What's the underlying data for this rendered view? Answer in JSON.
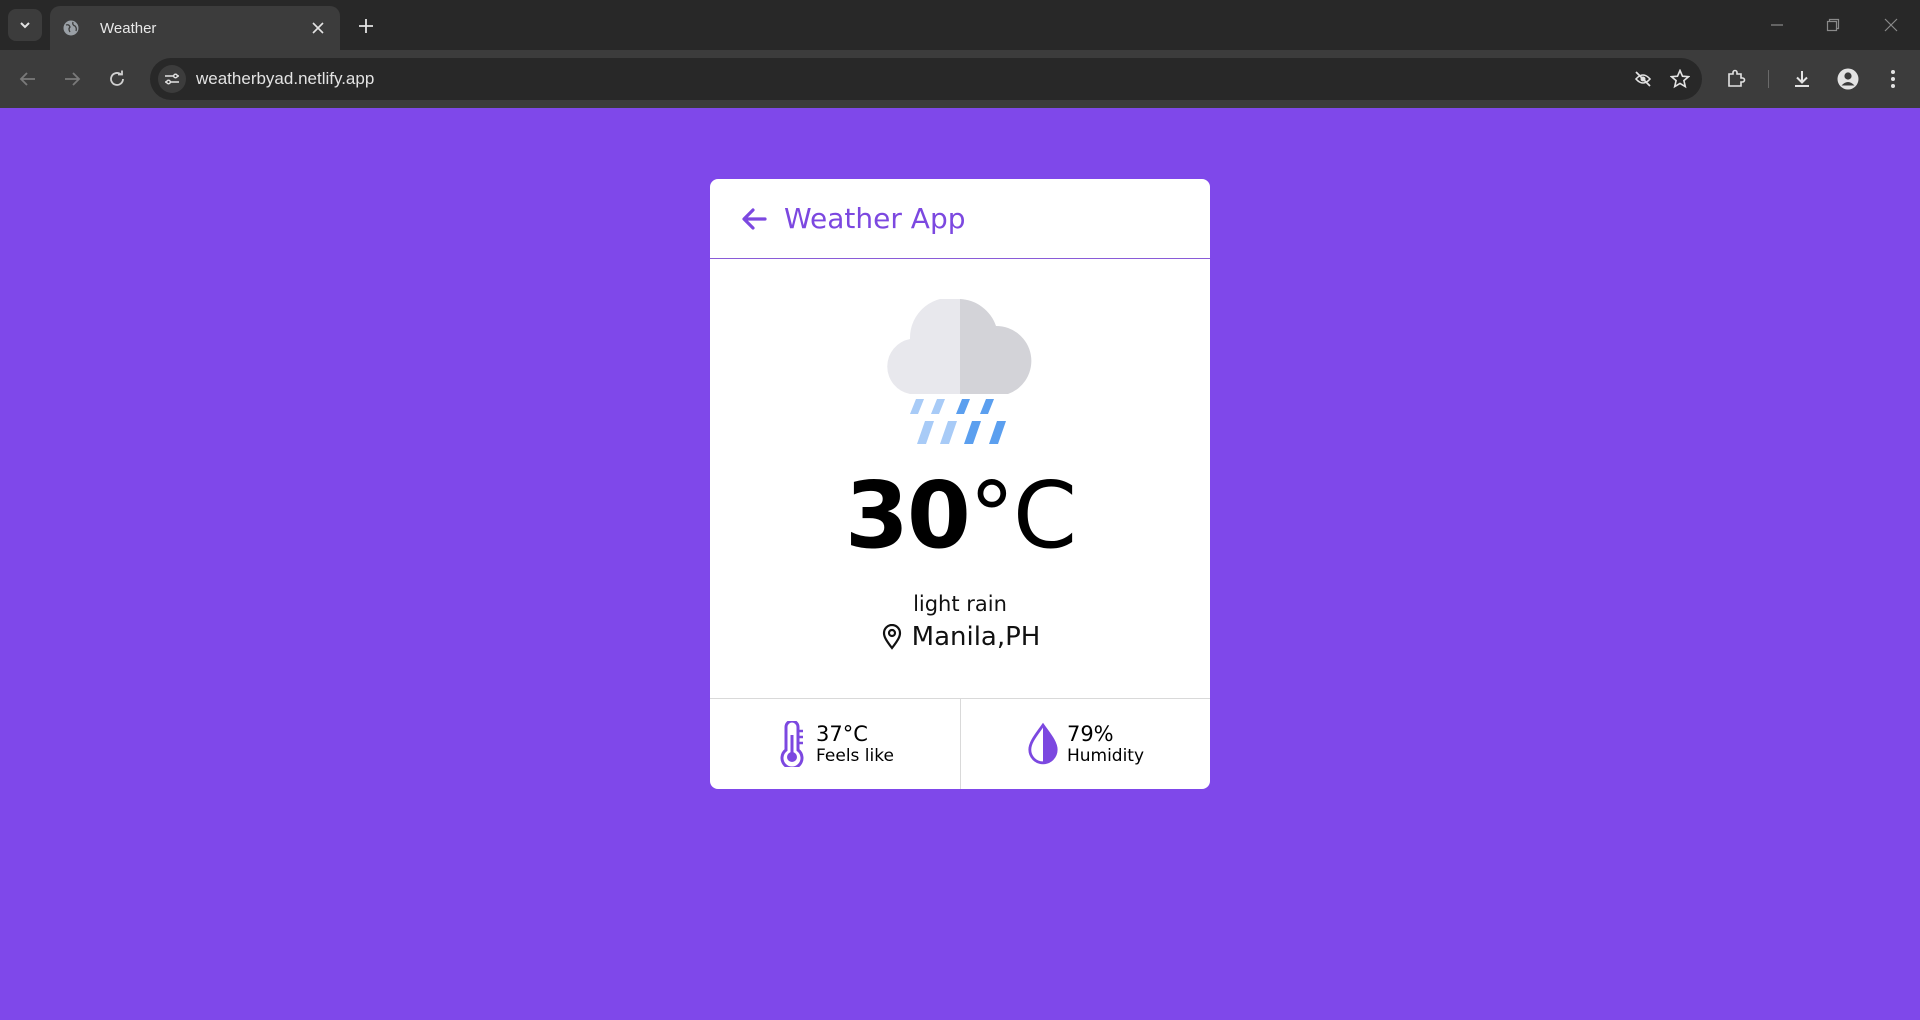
{
  "browser": {
    "tab": {
      "title": "Weather"
    },
    "url": "weatherbyad.netlify.app"
  },
  "app": {
    "title": "Weather App",
    "temperature": {
      "value": "30",
      "unit": "°C"
    },
    "description": "light rain",
    "location": "Manila,PH",
    "stats": [
      {
        "value": "37°C",
        "label": "Feels like",
        "icon": "thermometer-icon"
      },
      {
        "value": "79%",
        "label": "Humidity",
        "icon": "water-drop-icon"
      }
    ]
  },
  "colors": {
    "background": "#7f48ea",
    "accent": "#7c48e0",
    "card": "#ffffff"
  }
}
